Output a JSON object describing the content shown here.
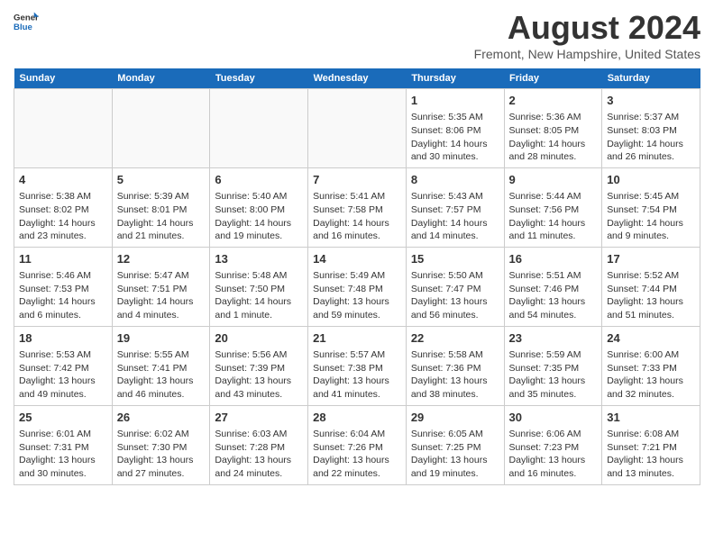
{
  "logo": {
    "general": "General",
    "blue": "Blue"
  },
  "title": "August 2024",
  "subtitle": "Fremont, New Hampshire, United States",
  "headers": [
    "Sunday",
    "Monday",
    "Tuesday",
    "Wednesday",
    "Thursday",
    "Friday",
    "Saturday"
  ],
  "weeks": [
    [
      {
        "date": "",
        "info": ""
      },
      {
        "date": "",
        "info": ""
      },
      {
        "date": "",
        "info": ""
      },
      {
        "date": "",
        "info": ""
      },
      {
        "date": "1",
        "info": "Sunrise: 5:35 AM\nSunset: 8:06 PM\nDaylight: 14 hours\nand 30 minutes."
      },
      {
        "date": "2",
        "info": "Sunrise: 5:36 AM\nSunset: 8:05 PM\nDaylight: 14 hours\nand 28 minutes."
      },
      {
        "date": "3",
        "info": "Sunrise: 5:37 AM\nSunset: 8:03 PM\nDaylight: 14 hours\nand 26 minutes."
      }
    ],
    [
      {
        "date": "4",
        "info": "Sunrise: 5:38 AM\nSunset: 8:02 PM\nDaylight: 14 hours\nand 23 minutes."
      },
      {
        "date": "5",
        "info": "Sunrise: 5:39 AM\nSunset: 8:01 PM\nDaylight: 14 hours\nand 21 minutes."
      },
      {
        "date": "6",
        "info": "Sunrise: 5:40 AM\nSunset: 8:00 PM\nDaylight: 14 hours\nand 19 minutes."
      },
      {
        "date": "7",
        "info": "Sunrise: 5:41 AM\nSunset: 7:58 PM\nDaylight: 14 hours\nand 16 minutes."
      },
      {
        "date": "8",
        "info": "Sunrise: 5:43 AM\nSunset: 7:57 PM\nDaylight: 14 hours\nand 14 minutes."
      },
      {
        "date": "9",
        "info": "Sunrise: 5:44 AM\nSunset: 7:56 PM\nDaylight: 14 hours\nand 11 minutes."
      },
      {
        "date": "10",
        "info": "Sunrise: 5:45 AM\nSunset: 7:54 PM\nDaylight: 14 hours\nand 9 minutes."
      }
    ],
    [
      {
        "date": "11",
        "info": "Sunrise: 5:46 AM\nSunset: 7:53 PM\nDaylight: 14 hours\nand 6 minutes."
      },
      {
        "date": "12",
        "info": "Sunrise: 5:47 AM\nSunset: 7:51 PM\nDaylight: 14 hours\nand 4 minutes."
      },
      {
        "date": "13",
        "info": "Sunrise: 5:48 AM\nSunset: 7:50 PM\nDaylight: 14 hours\nand 1 minute."
      },
      {
        "date": "14",
        "info": "Sunrise: 5:49 AM\nSunset: 7:48 PM\nDaylight: 13 hours\nand 59 minutes."
      },
      {
        "date": "15",
        "info": "Sunrise: 5:50 AM\nSunset: 7:47 PM\nDaylight: 13 hours\nand 56 minutes."
      },
      {
        "date": "16",
        "info": "Sunrise: 5:51 AM\nSunset: 7:46 PM\nDaylight: 13 hours\nand 54 minutes."
      },
      {
        "date": "17",
        "info": "Sunrise: 5:52 AM\nSunset: 7:44 PM\nDaylight: 13 hours\nand 51 minutes."
      }
    ],
    [
      {
        "date": "18",
        "info": "Sunrise: 5:53 AM\nSunset: 7:42 PM\nDaylight: 13 hours\nand 49 minutes."
      },
      {
        "date": "19",
        "info": "Sunrise: 5:55 AM\nSunset: 7:41 PM\nDaylight: 13 hours\nand 46 minutes."
      },
      {
        "date": "20",
        "info": "Sunrise: 5:56 AM\nSunset: 7:39 PM\nDaylight: 13 hours\nand 43 minutes."
      },
      {
        "date": "21",
        "info": "Sunrise: 5:57 AM\nSunset: 7:38 PM\nDaylight: 13 hours\nand 41 minutes."
      },
      {
        "date": "22",
        "info": "Sunrise: 5:58 AM\nSunset: 7:36 PM\nDaylight: 13 hours\nand 38 minutes."
      },
      {
        "date": "23",
        "info": "Sunrise: 5:59 AM\nSunset: 7:35 PM\nDaylight: 13 hours\nand 35 minutes."
      },
      {
        "date": "24",
        "info": "Sunrise: 6:00 AM\nSunset: 7:33 PM\nDaylight: 13 hours\nand 32 minutes."
      }
    ],
    [
      {
        "date": "25",
        "info": "Sunrise: 6:01 AM\nSunset: 7:31 PM\nDaylight: 13 hours\nand 30 minutes."
      },
      {
        "date": "26",
        "info": "Sunrise: 6:02 AM\nSunset: 7:30 PM\nDaylight: 13 hours\nand 27 minutes."
      },
      {
        "date": "27",
        "info": "Sunrise: 6:03 AM\nSunset: 7:28 PM\nDaylight: 13 hours\nand 24 minutes."
      },
      {
        "date": "28",
        "info": "Sunrise: 6:04 AM\nSunset: 7:26 PM\nDaylight: 13 hours\nand 22 minutes."
      },
      {
        "date": "29",
        "info": "Sunrise: 6:05 AM\nSunset: 7:25 PM\nDaylight: 13 hours\nand 19 minutes."
      },
      {
        "date": "30",
        "info": "Sunrise: 6:06 AM\nSunset: 7:23 PM\nDaylight: 13 hours\nand 16 minutes."
      },
      {
        "date": "31",
        "info": "Sunrise: 6:08 AM\nSunset: 7:21 PM\nDaylight: 13 hours\nand 13 minutes."
      }
    ]
  ]
}
